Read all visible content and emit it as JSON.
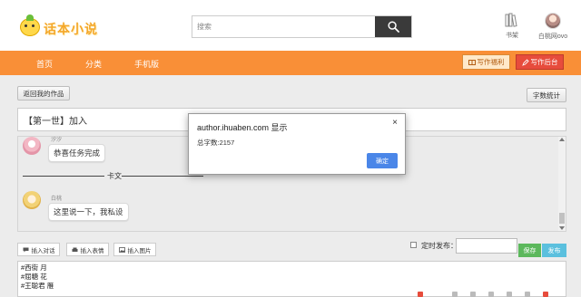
{
  "header": {
    "logo_text": "话本小说",
    "search": {
      "placeholder": "搜索"
    },
    "shelf_label": "书架",
    "user_name": "白桃网ovo"
  },
  "nav": {
    "items": [
      "首页",
      "分类",
      "手机版"
    ],
    "fuli_label": "写作福利",
    "backend_label": "写作后台"
  },
  "toolbar": {
    "back_label": "返回我的作品",
    "wordcount_label": "字数统计"
  },
  "chapter": {
    "title": "【第一世】加入"
  },
  "chat": {
    "messages": [
      {
        "name": "汐汐",
        "text": "恭喜任务完成"
      },
      {
        "name": "白桃",
        "text": "这里说一下，我私设"
      }
    ],
    "divider": "卡文"
  },
  "editor_tools": {
    "insert_dialog": "插入对话",
    "insert_emoji": "插入表情",
    "insert_image": "插入图片",
    "timed_publish": "定时发布：",
    "save": "保存",
    "publish": "发布"
  },
  "editor_text": [
    "#西街 月",
    "#屈糖 花",
    "#王聪君 雁"
  ],
  "dialog": {
    "title": "author.ihuaben.com 显示",
    "message": "总字数:2157",
    "ok": "确定",
    "close": "×"
  },
  "colors": {
    "nav_bg": "#f98f37",
    "backend_btn": "#e74c3c",
    "save_btn": "#5cb85c",
    "publish_btn": "#5bc0de",
    "dialog_ok": "#4a86e8"
  }
}
